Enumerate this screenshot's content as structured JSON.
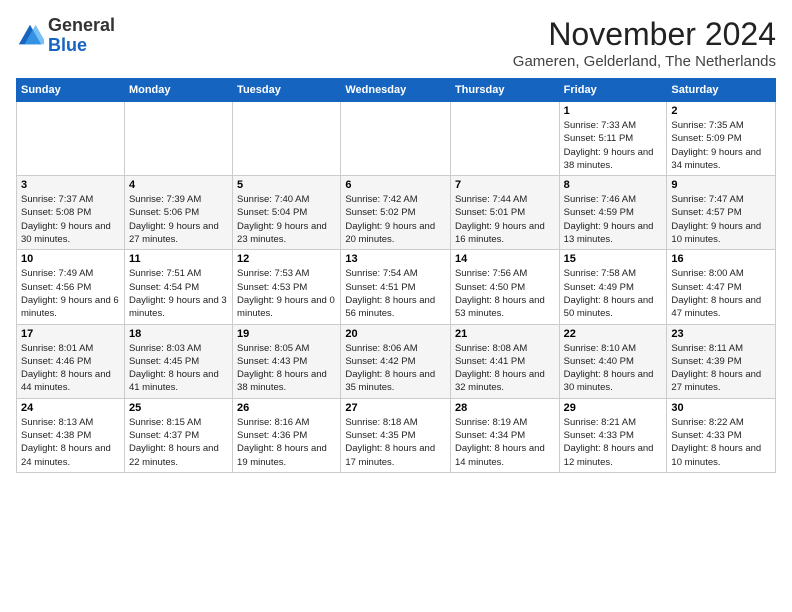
{
  "logo": {
    "general": "General",
    "blue": "Blue"
  },
  "header": {
    "month_year": "November 2024",
    "location": "Gameren, Gelderland, The Netherlands"
  },
  "days_of_week": [
    "Sunday",
    "Monday",
    "Tuesday",
    "Wednesday",
    "Thursday",
    "Friday",
    "Saturday"
  ],
  "weeks": [
    [
      {
        "day": "",
        "info": ""
      },
      {
        "day": "",
        "info": ""
      },
      {
        "day": "",
        "info": ""
      },
      {
        "day": "",
        "info": ""
      },
      {
        "day": "",
        "info": ""
      },
      {
        "day": "1",
        "info": "Sunrise: 7:33 AM\nSunset: 5:11 PM\nDaylight: 9 hours and 38 minutes."
      },
      {
        "day": "2",
        "info": "Sunrise: 7:35 AM\nSunset: 5:09 PM\nDaylight: 9 hours and 34 minutes."
      }
    ],
    [
      {
        "day": "3",
        "info": "Sunrise: 7:37 AM\nSunset: 5:08 PM\nDaylight: 9 hours and 30 minutes."
      },
      {
        "day": "4",
        "info": "Sunrise: 7:39 AM\nSunset: 5:06 PM\nDaylight: 9 hours and 27 minutes."
      },
      {
        "day": "5",
        "info": "Sunrise: 7:40 AM\nSunset: 5:04 PM\nDaylight: 9 hours and 23 minutes."
      },
      {
        "day": "6",
        "info": "Sunrise: 7:42 AM\nSunset: 5:02 PM\nDaylight: 9 hours and 20 minutes."
      },
      {
        "day": "7",
        "info": "Sunrise: 7:44 AM\nSunset: 5:01 PM\nDaylight: 9 hours and 16 minutes."
      },
      {
        "day": "8",
        "info": "Sunrise: 7:46 AM\nSunset: 4:59 PM\nDaylight: 9 hours and 13 minutes."
      },
      {
        "day": "9",
        "info": "Sunrise: 7:47 AM\nSunset: 4:57 PM\nDaylight: 9 hours and 10 minutes."
      }
    ],
    [
      {
        "day": "10",
        "info": "Sunrise: 7:49 AM\nSunset: 4:56 PM\nDaylight: 9 hours and 6 minutes."
      },
      {
        "day": "11",
        "info": "Sunrise: 7:51 AM\nSunset: 4:54 PM\nDaylight: 9 hours and 3 minutes."
      },
      {
        "day": "12",
        "info": "Sunrise: 7:53 AM\nSunset: 4:53 PM\nDaylight: 9 hours and 0 minutes."
      },
      {
        "day": "13",
        "info": "Sunrise: 7:54 AM\nSunset: 4:51 PM\nDaylight: 8 hours and 56 minutes."
      },
      {
        "day": "14",
        "info": "Sunrise: 7:56 AM\nSunset: 4:50 PM\nDaylight: 8 hours and 53 minutes."
      },
      {
        "day": "15",
        "info": "Sunrise: 7:58 AM\nSunset: 4:49 PM\nDaylight: 8 hours and 50 minutes."
      },
      {
        "day": "16",
        "info": "Sunrise: 8:00 AM\nSunset: 4:47 PM\nDaylight: 8 hours and 47 minutes."
      }
    ],
    [
      {
        "day": "17",
        "info": "Sunrise: 8:01 AM\nSunset: 4:46 PM\nDaylight: 8 hours and 44 minutes."
      },
      {
        "day": "18",
        "info": "Sunrise: 8:03 AM\nSunset: 4:45 PM\nDaylight: 8 hours and 41 minutes."
      },
      {
        "day": "19",
        "info": "Sunrise: 8:05 AM\nSunset: 4:43 PM\nDaylight: 8 hours and 38 minutes."
      },
      {
        "day": "20",
        "info": "Sunrise: 8:06 AM\nSunset: 4:42 PM\nDaylight: 8 hours and 35 minutes."
      },
      {
        "day": "21",
        "info": "Sunrise: 8:08 AM\nSunset: 4:41 PM\nDaylight: 8 hours and 32 minutes."
      },
      {
        "day": "22",
        "info": "Sunrise: 8:10 AM\nSunset: 4:40 PM\nDaylight: 8 hours and 30 minutes."
      },
      {
        "day": "23",
        "info": "Sunrise: 8:11 AM\nSunset: 4:39 PM\nDaylight: 8 hours and 27 minutes."
      }
    ],
    [
      {
        "day": "24",
        "info": "Sunrise: 8:13 AM\nSunset: 4:38 PM\nDaylight: 8 hours and 24 minutes."
      },
      {
        "day": "25",
        "info": "Sunrise: 8:15 AM\nSunset: 4:37 PM\nDaylight: 8 hours and 22 minutes."
      },
      {
        "day": "26",
        "info": "Sunrise: 8:16 AM\nSunset: 4:36 PM\nDaylight: 8 hours and 19 minutes."
      },
      {
        "day": "27",
        "info": "Sunrise: 8:18 AM\nSunset: 4:35 PM\nDaylight: 8 hours and 17 minutes."
      },
      {
        "day": "28",
        "info": "Sunrise: 8:19 AM\nSunset: 4:34 PM\nDaylight: 8 hours and 14 minutes."
      },
      {
        "day": "29",
        "info": "Sunrise: 8:21 AM\nSunset: 4:33 PM\nDaylight: 8 hours and 12 minutes."
      },
      {
        "day": "30",
        "info": "Sunrise: 8:22 AM\nSunset: 4:33 PM\nDaylight: 8 hours and 10 minutes."
      }
    ]
  ]
}
